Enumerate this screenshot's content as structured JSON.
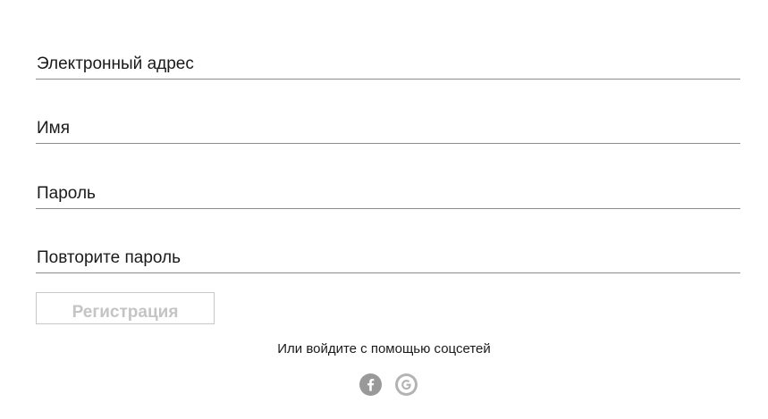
{
  "form": {
    "fields": [
      {
        "placeholder": "Электронный адрес",
        "value": ""
      },
      {
        "placeholder": "Имя",
        "value": ""
      },
      {
        "placeholder": "Пароль",
        "value": ""
      },
      {
        "placeholder": "Повторите пароль",
        "value": ""
      }
    ],
    "submit_label": "Регистрация"
  },
  "social": {
    "prompt": "Или войдите с помощью соцсетей",
    "providers": [
      {
        "icon": "facebook-icon",
        "glyph": "f"
      },
      {
        "icon": "google-icon",
        "glyph": "G"
      }
    ]
  },
  "colors": {
    "underline": "#8c8c8c",
    "button_border": "#c8c8c8",
    "button_text": "#c4c4c4",
    "icon": "#999999"
  }
}
